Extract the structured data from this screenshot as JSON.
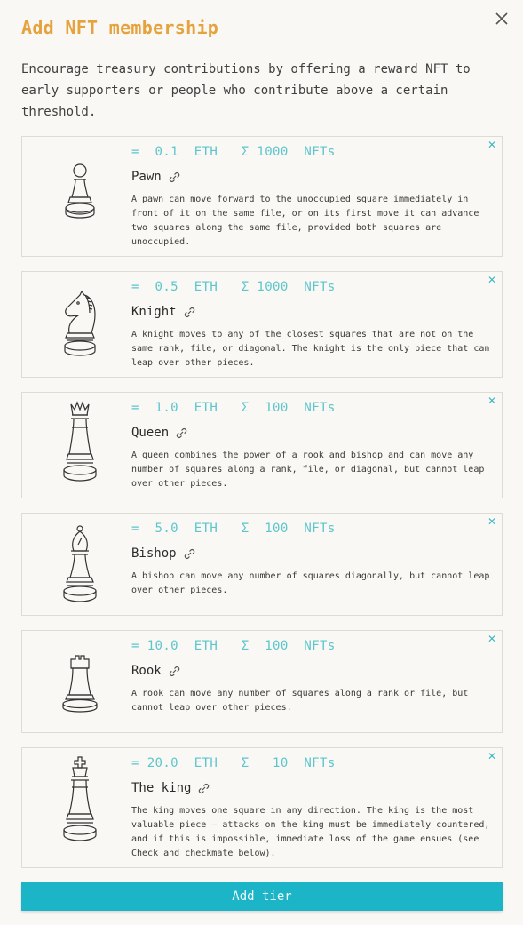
{
  "modal": {
    "title": "Add NFT membership",
    "description": "Encourage treasury contributions by offering a reward NFT to early supporters or people who contribute above a certain threshold.",
    "close_icon": "close-icon",
    "add_button_label": "Add tier"
  },
  "colors": {
    "accent_title": "#e6a23c",
    "accent_teal": "#5cc6cc",
    "button_bg": "#1bb5c7"
  },
  "tiers": [
    {
      "price_prefix": "=",
      "price": "0.1",
      "currency": "ETH",
      "sum_symbol": "Σ",
      "supply": "1000",
      "supply_unit": "NFTs",
      "name": "Pawn",
      "icon": "pawn-icon",
      "description": "A pawn can move forward to the unoccupied square immediately in front of it on the same file, or on its first move it can advance two squares along the same file, provided both squares are unoccupied."
    },
    {
      "price_prefix": "=",
      "price": "0.5",
      "currency": "ETH",
      "sum_symbol": "Σ",
      "supply": "1000",
      "supply_unit": "NFTs",
      "name": "Knight",
      "icon": "knight-icon",
      "description": "A knight moves to any of the closest squares that are not on the same rank, file, or diagonal. The knight is the only piece that can leap over other pieces."
    },
    {
      "price_prefix": "=",
      "price": "1.0",
      "currency": "ETH",
      "sum_symbol": "Σ",
      "supply": "100",
      "supply_unit": "NFTs",
      "name": "Queen",
      "icon": "queen-icon",
      "description": "A queen combines the power of a rook and bishop and can move any number of squares along a rank, file, or diagonal, but cannot leap over other pieces."
    },
    {
      "price_prefix": "=",
      "price": "5.0",
      "currency": "ETH",
      "sum_symbol": "Σ",
      "supply": "100",
      "supply_unit": "NFTs",
      "name": "Bishop",
      "icon": "bishop-icon",
      "description": "A bishop can move any number of squares diagonally, but cannot leap over other pieces."
    },
    {
      "price_prefix": "=",
      "price": "10.0",
      "currency": "ETH",
      "sum_symbol": "Σ",
      "supply": "100",
      "supply_unit": "NFTs",
      "name": "Rook",
      "icon": "rook-icon",
      "description": "A rook can move any number of squares along a rank or file, but cannot leap over other pieces."
    },
    {
      "price_prefix": "=",
      "price": "20.0",
      "currency": "ETH",
      "sum_symbol": "Σ",
      "supply": "10",
      "supply_unit": "NFTs",
      "name": "The king",
      "icon": "king-icon",
      "description": "The king moves one square in any direction. The king is the most valuable piece — attacks on the king must be immediately countered, and if this is impossible, immediate loss of the game ensues (see Check and checkmate below)."
    }
  ]
}
